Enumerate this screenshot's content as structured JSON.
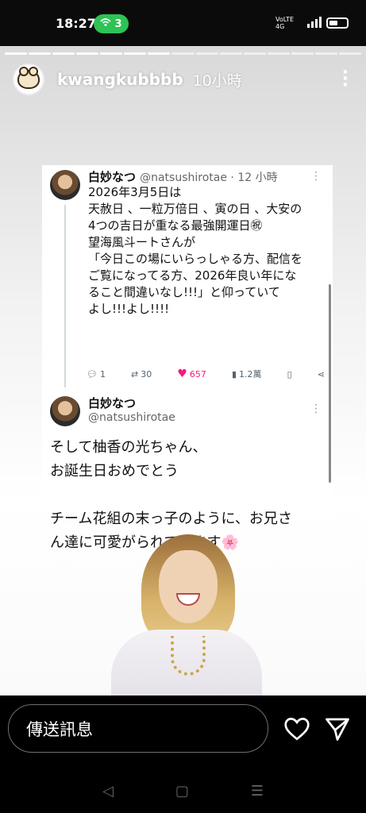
{
  "status_bar": {
    "time": "18:27",
    "hotspot_count": "3",
    "network": "VoLTE 4G"
  },
  "story": {
    "progress_segments": 15,
    "progress_completed": 7,
    "username": "kwangkubbbb",
    "time_ago": "10小時"
  },
  "tweet1": {
    "name": "白妙なつ",
    "handle": "@natsushirotae · 12 小時",
    "lines": [
      "2026年3月5日は",
      "天赦日 、一粒万倍日 、寅の日 、大安の",
      "4つの吉日が重なる最強開運日㊗",
      "望海風斗ートさんが",
      "「今日この場にいらっしゃる方、配信を",
      "ご覧になってる方、2026年良い年にな",
      "ること間違いなし!!!」と仰っていて",
      "よし!!!よし!!!!"
    ],
    "replies": "1",
    "retweets": "30",
    "likes": "657",
    "views": "1.2萬"
  },
  "tweet2": {
    "name": "白妙なつ",
    "handle": "@natsushirotae",
    "lines": [
      "そして柚香の光ちゃん、",
      "お誕生日おめでとう",
      "",
      "チーム花組の末っ子のように、お兄さ",
      "ん達に可愛がられています🌸"
    ]
  },
  "composer": {
    "placeholder": "傳送訊息"
  },
  "icons": {
    "like": "heart-icon",
    "send": "send-icon",
    "more": "more-vertical-icon"
  },
  "colors": {
    "hotspot": "#2fc254",
    "like": "#f91880"
  }
}
